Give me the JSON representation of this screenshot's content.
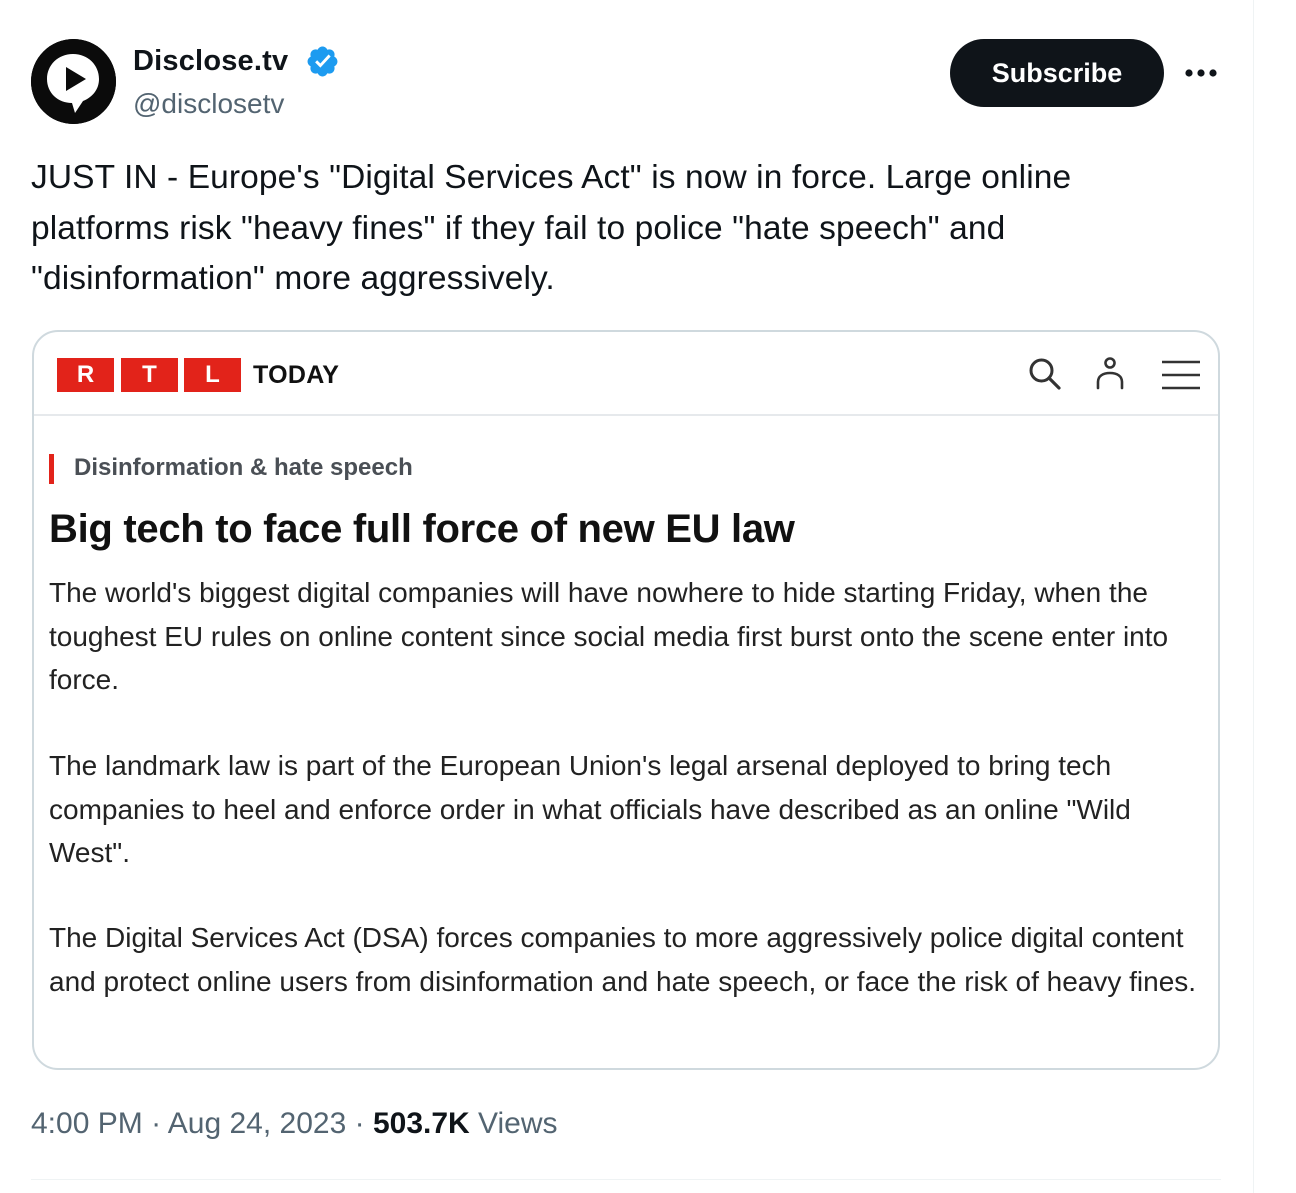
{
  "author": {
    "display_name": "Disclose.tv",
    "handle": "@disclosetv",
    "verified": true,
    "avatar_icon": "play-bubble-icon"
  },
  "actions": {
    "subscribe_label": "Subscribe",
    "more_icon": "more-horizontal-icon"
  },
  "tweet": {
    "text": "JUST IN - Europe's \"Digital Services Act\" is now in force. Large online platforms risk \"heavy fines\" if they fail to police \"hate speech\" and \"disinformation\" more aggressively."
  },
  "card": {
    "logo_letters": [
      "R",
      "T",
      "L"
    ],
    "logo_suffix": "TODAY",
    "header_icons": [
      "search-icon",
      "user-icon",
      "menu-icon"
    ],
    "category": "Disinformation & hate speech",
    "headline": "Big tech to face full force of new EU law",
    "paragraphs": [
      "The world's biggest digital companies will have nowhere to hide starting Friday, when the toughest EU rules on online content since social media first burst onto the scene enter into force.",
      "The landmark law is part of the European Union's legal arsenal deployed to bring tech companies to heel and enforce order in what officials have described as an online \"Wild West\".",
      "The Digital Services Act (DSA) forces companies to more aggressively police digital content and protect online users from disinformation and hate speech, or face the risk of heavy fines."
    ],
    "brand_color": "#e2231a"
  },
  "meta": {
    "time": "4:00 PM",
    "separator": "·",
    "date": "Aug 24, 2023",
    "views_count": "503.7K",
    "views_label": "Views"
  },
  "colors": {
    "text": "#0f1419",
    "secondary": "#536471",
    "verified": "#1d9bf0",
    "border": "#cfd9de"
  }
}
